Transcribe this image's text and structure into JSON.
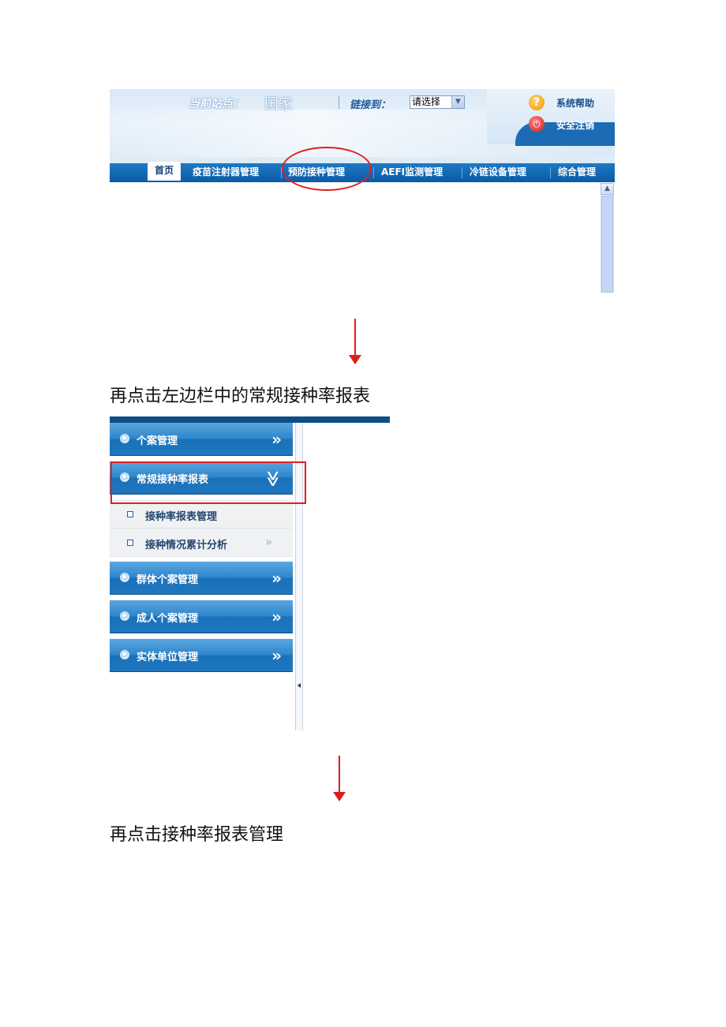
{
  "header": {
    "site_label": "当前站点：",
    "site_value": "国家",
    "link_label": "链接到：",
    "link_select_value": "请选择",
    "help_icon": "help-icon",
    "help_text": "系统帮助",
    "logout_icon": "power-icon",
    "logout_text": "安全注销"
  },
  "nav_tabs": [
    {
      "label": "首页",
      "active": true
    },
    {
      "label": "疫苗注射器管理"
    },
    {
      "label": "预防接种管理"
    },
    {
      "label": "AEFI监测管理"
    },
    {
      "label": "冷链设备管理"
    },
    {
      "label": "综合管理"
    }
  ],
  "captions": {
    "step1": "再点击左边栏中的常规接种率报表",
    "step2": "再点击接种率报表管理"
  },
  "sidebar": {
    "items": [
      {
        "label": "个案管理",
        "chevron": "»"
      },
      {
        "label": "常规接种率报表",
        "chevron": "≫"
      },
      {
        "label": "群体个案管理",
        "chevron": "»"
      },
      {
        "label": "成人个案管理",
        "chevron": "»"
      },
      {
        "label": "实体单位管理",
        "chevron": "»"
      }
    ],
    "subitems": [
      {
        "label": "接种率报表管理"
      },
      {
        "label": "接种情况累计分析",
        "chevron": "»"
      }
    ]
  },
  "annotation_colors": {
    "highlight": "#e02020",
    "header_blue": "#0b5aa6"
  }
}
